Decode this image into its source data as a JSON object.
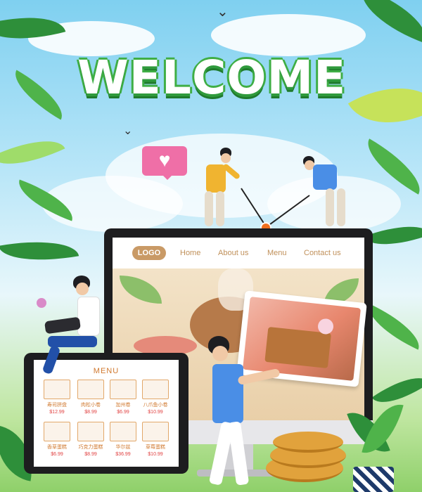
{
  "banner": {
    "title": "WELCOME"
  },
  "site": {
    "nav": {
      "logo": "LOGO",
      "links": [
        "Home",
        "About us",
        "Menu",
        "Contact us"
      ]
    }
  },
  "tablet_menu": {
    "title": "MENU",
    "items": [
      {
        "name": "寿司拼盘",
        "price": "$12.99"
      },
      {
        "name": "肉松小卷",
        "price": "$8.99"
      },
      {
        "name": "加州卷",
        "price": "$6.99"
      },
      {
        "name": "八爪鱼小卷",
        "price": "$10.99"
      },
      {
        "name": "香草蛋糕",
        "price": "$6.99"
      },
      {
        "name": "巧克力蛋糕",
        "price": "$8.99"
      },
      {
        "name": "华尔兹",
        "price": "$36.99"
      },
      {
        "name": "草莓蛋糕",
        "price": "$10.99"
      }
    ]
  },
  "icons": {
    "heart_bubble": "heart-icon"
  },
  "colors": {
    "welcome_green": "#3fae45",
    "nav_accent": "#c99a66",
    "menu_orange": "#d0782e",
    "price_red": "#e04040",
    "heart_pink": "#ef6fa7"
  }
}
